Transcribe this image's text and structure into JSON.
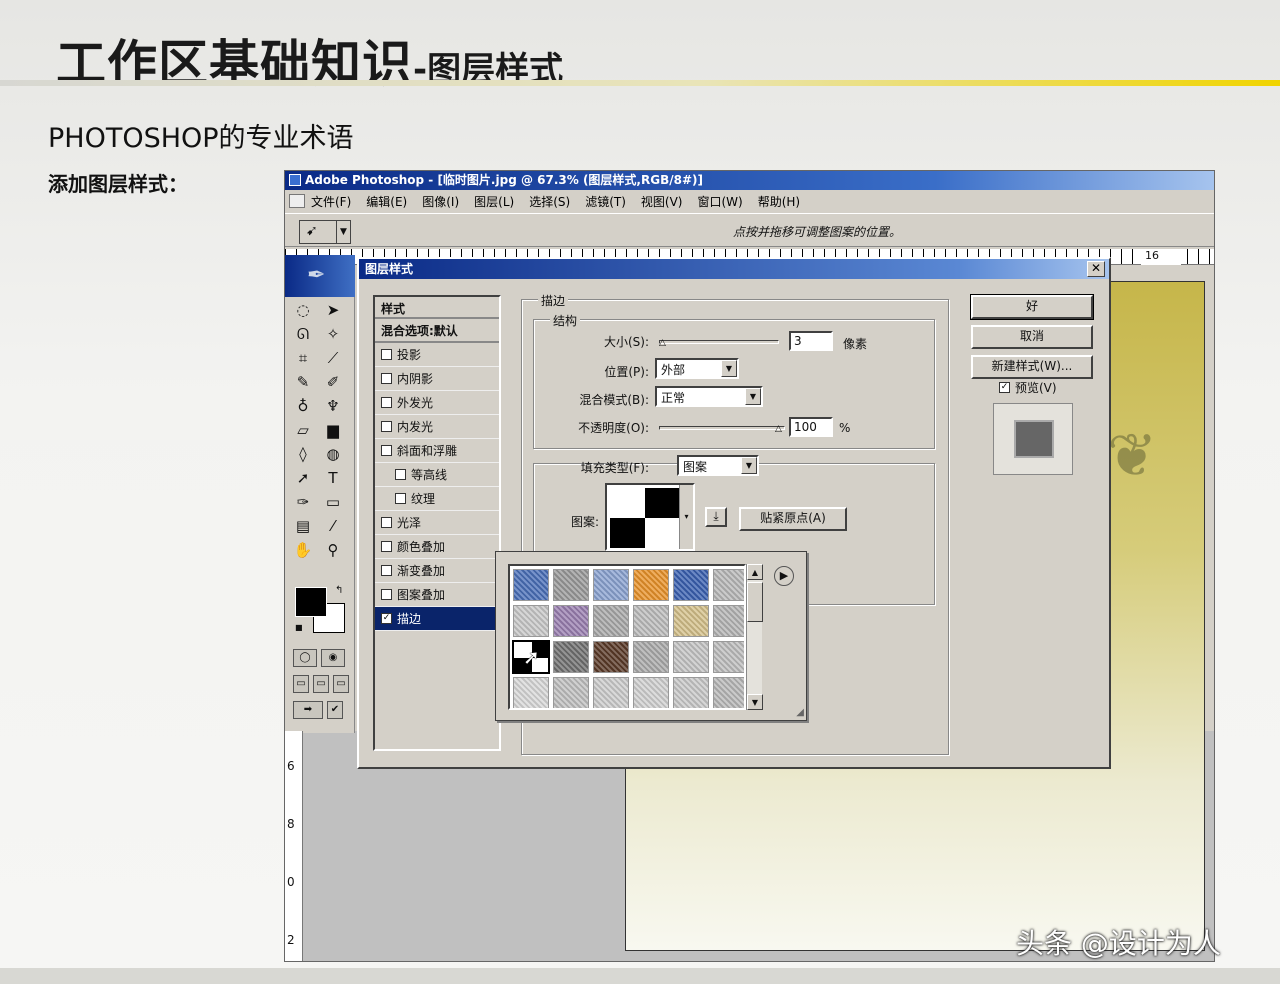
{
  "slide": {
    "title": "工作区基础知识",
    "title_suffix": "-图层样式",
    "subtitle": "PHOTOSHOP的专业术语",
    "label": "添加图层样式：",
    "watermark": "头条 @设计为人"
  },
  "photoshop": {
    "window_title": "Adobe Photoshop - [临时图片.jpg @ 67.3% (图层样式,RGB/8#)]",
    "menu": [
      "文件(F)",
      "编辑(E)",
      "图像(I)",
      "图层(L)",
      "选择(S)",
      "滤镜(T)",
      "视图(V)",
      "窗口(W)",
      "帮助(H)"
    ],
    "options_hint": "点按并拖移可调整图案的位置。",
    "ruler_top_label": "16",
    "ruler_left_labels": [
      "6",
      "8",
      "0",
      "2"
    ],
    "tools": [
      "marquee-tool",
      "move-tool",
      "lasso-tool",
      "magic-wand-tool",
      "crop-tool",
      "slice-tool",
      "healing-brush-tool",
      "brush-tool",
      "clone-stamp-tool",
      "history-brush-tool",
      "eraser-tool",
      "gradient-tool",
      "blur-tool",
      "dodge-tool",
      "path-selection-tool",
      "type-tool",
      "pen-tool",
      "shape-tool",
      "notes-tool",
      "eyedropper-tool",
      "hand-tool",
      "zoom-tool"
    ],
    "colors": {
      "foreground": "#000000",
      "background": "#ffffff"
    }
  },
  "dialog": {
    "title": "图层样式",
    "styles_header": "样式",
    "blend_item": "混合选项:默认",
    "style_items": [
      {
        "label": "投影",
        "checked": false,
        "sub": false
      },
      {
        "label": "内阴影",
        "checked": false,
        "sub": false
      },
      {
        "label": "外发光",
        "checked": false,
        "sub": false
      },
      {
        "label": "内发光",
        "checked": false,
        "sub": false
      },
      {
        "label": "斜面和浮雕",
        "checked": false,
        "sub": false
      },
      {
        "label": "等高线",
        "checked": false,
        "sub": true
      },
      {
        "label": "纹理",
        "checked": false,
        "sub": true
      },
      {
        "label": "光泽",
        "checked": false,
        "sub": false
      },
      {
        "label": "颜色叠加",
        "checked": false,
        "sub": false
      },
      {
        "label": "渐变叠加",
        "checked": false,
        "sub": false
      },
      {
        "label": "图案叠加",
        "checked": false,
        "sub": false
      },
      {
        "label": "描边",
        "checked": true,
        "sub": false,
        "selected": true
      }
    ],
    "stroke_group": "描边",
    "structure_group": "结构",
    "size_label": "大小(S):",
    "size_value": "3",
    "size_unit": "像素",
    "position_label": "位置(P):",
    "position_value": "外部",
    "blend_mode_label": "混合模式(B):",
    "blend_mode_value": "正常",
    "opacity_label": "不透明度(O):",
    "opacity_value": "100",
    "opacity_unit": "%",
    "fill_type_label": "填充类型(F):",
    "fill_type_value": "图案",
    "pattern_label": "图案:",
    "snap_origin_button": "贴紧原点(A)",
    "ok_button": "好",
    "cancel_button": "取消",
    "new_style_button": "新建样式(W)...",
    "preview_label": "预览(V)",
    "preview_checked": true
  },
  "pattern_picker": {
    "swatches": [
      "#4a6fb8",
      "#9a9a9a",
      "#8aa2d0",
      "#e8922a",
      "#3a60b0",
      "#b8b8b8",
      "#c8c8c8",
      "#9a7fb0",
      "#a8a8a8",
      "#bcbcbc",
      "#d4c08a",
      "#b4b4b4",
      "#000000",
      "#707070",
      "#5a3a28",
      "#aaaaaa",
      "#c4c4c4",
      "#bdbdbd",
      "#d8d8d8",
      "#c0c0c0",
      "#cccccc",
      "#d0d0d0",
      "#c8c8c8",
      "#b8b8b8"
    ],
    "selected_index": 12
  }
}
